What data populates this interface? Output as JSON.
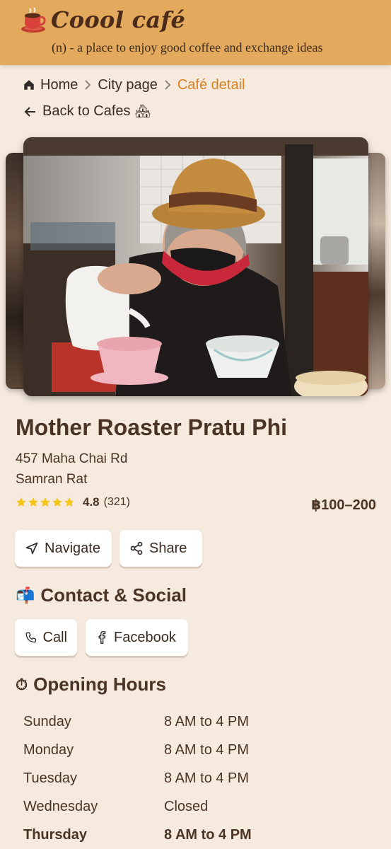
{
  "header": {
    "brand_emoji": "☕",
    "title": "Coool café",
    "tagline": "(n) - a place to enjoy good coffee and exchange ideas"
  },
  "breadcrumb": {
    "home": "Home",
    "city": "City page",
    "current": "Café detail"
  },
  "back_link": {
    "label": "Back to Cafes",
    "emoji": "🏘"
  },
  "cafe": {
    "name": "Mother Roaster Pratu Phi",
    "address_line1": "457 Maha Chai Rd",
    "address_line2": "Samran Rat",
    "rating": "4.8",
    "rating_stars": 4.8,
    "review_count": "(321)",
    "price_range": "฿100–200"
  },
  "actions": {
    "navigate": "Navigate",
    "share": "Share"
  },
  "contact": {
    "emoji": "📬",
    "title": "Contact & Social",
    "call": "Call",
    "facebook": "Facebook"
  },
  "hours": {
    "emoji": "⏱",
    "title": "Opening Hours",
    "rows": [
      {
        "day": "Sunday",
        "time": "8 AM to 4 PM"
      },
      {
        "day": "Monday",
        "time": "8 AM to 4 PM"
      },
      {
        "day": "Tuesday",
        "time": "8 AM to 4 PM"
      },
      {
        "day": "Wednesday",
        "time": "Closed"
      },
      {
        "day": "Thursday",
        "time": "8 AM to 4 PM"
      }
    ],
    "highlighted_day": "Thursday"
  },
  "colors": {
    "header_bg": "#e3aa5e",
    "page_bg": "#f6eade",
    "accent": "#d9821f",
    "text": "#4a3426",
    "star": "#f5c518"
  }
}
